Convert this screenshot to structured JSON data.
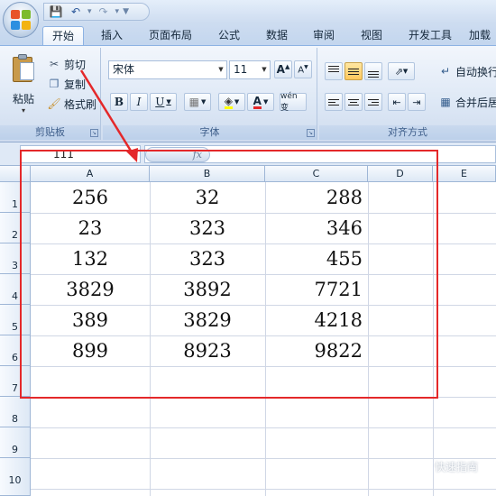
{
  "ribbon_tabs": [
    {
      "label": "开始",
      "active": true
    },
    {
      "label": "插入"
    },
    {
      "label": "页面布局"
    },
    {
      "label": "公式"
    },
    {
      "label": "数据"
    },
    {
      "label": "审阅"
    },
    {
      "label": "视图"
    },
    {
      "label": "开发工具"
    },
    {
      "label": "加载"
    }
  ],
  "clipboard": {
    "paste": "粘贴",
    "cut": "剪切",
    "copy": "复制",
    "format_painter": "格式刷",
    "group_label": "剪贴板"
  },
  "font": {
    "name": "宋体",
    "size": "11",
    "bold": "B",
    "italic": "I",
    "underline": "U",
    "font_color_letter": "A",
    "phonetic": "wén 变",
    "group_label": "字体"
  },
  "alignment": {
    "wrap_text": "自动换行",
    "merge_center": "合并后居",
    "group_label": "对齐方式"
  },
  "formula_bar": {
    "name_box": "111",
    "fx": "fx"
  },
  "sheet": {
    "columns": [
      "A",
      "B",
      "C",
      "D",
      "E"
    ],
    "rows": [
      "1",
      "2",
      "3",
      "4",
      "5",
      "6",
      "7",
      "8",
      "9",
      "10"
    ],
    "cells": [
      [
        "256",
        "32",
        "288"
      ],
      [
        "23",
        "323",
        "346"
      ],
      [
        "132",
        "323",
        "455"
      ],
      [
        "3829",
        "3892",
        "7721"
      ],
      [
        "389",
        "3829",
        "4218"
      ],
      [
        "899",
        "8923",
        "9822"
      ]
    ]
  },
  "colors": {
    "highlight_box": "#e4282a",
    "ribbon_blue": "#dfe9f6",
    "active_alignment": "#ffc85c"
  },
  "watermark": "快速指南"
}
